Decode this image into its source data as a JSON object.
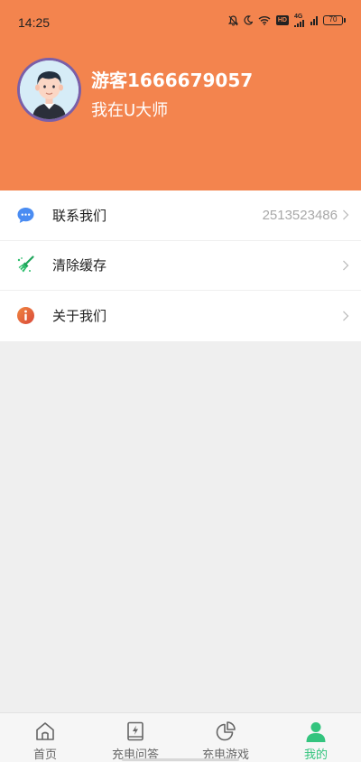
{
  "status_bar": {
    "time": "14:25",
    "icons": [
      "bell-muted-icon",
      "moon-icon",
      "wifi-icon",
      "hd-badge",
      "signal-4g-icon",
      "signal-icon",
      "battery-icon"
    ],
    "hd": "HD",
    "network": "4G",
    "battery": "70"
  },
  "profile": {
    "username": "游客1666679057",
    "tagline": "我在U大师",
    "header_color": "#f3844e"
  },
  "menu": {
    "items": [
      {
        "label": "联系我们",
        "value": "2513523486",
        "icon": "chat-bubble-icon"
      },
      {
        "label": "清除缓存",
        "value": "",
        "icon": "broom-icon"
      },
      {
        "label": "关于我们",
        "value": "",
        "icon": "info-icon"
      }
    ]
  },
  "tabbar": {
    "active_color": "#33c47e",
    "tabs": [
      {
        "label": "首页",
        "icon": "home-icon",
        "active": false
      },
      {
        "label": "充电问答",
        "icon": "book-bolt-icon",
        "active": false
      },
      {
        "label": "充电游戏",
        "icon": "pie-chart-icon",
        "active": false
      },
      {
        "label": "我的",
        "icon": "user-icon",
        "active": true
      }
    ]
  }
}
